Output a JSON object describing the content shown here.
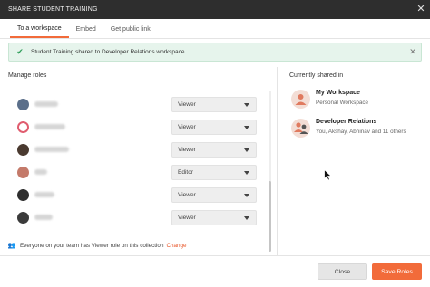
{
  "header": {
    "title": "SHARE STUDENT TRAINING",
    "close_icon": "close-icon"
  },
  "tabs": [
    {
      "label": "To a workspace",
      "active": true
    },
    {
      "label": "Embed",
      "active": false
    },
    {
      "label": "Get public link",
      "active": false
    }
  ],
  "banner": {
    "text": "Student Training shared to Developer Relations workspace.",
    "icon": "check-icon"
  },
  "manage_roles": {
    "title": "Manage roles",
    "rows": [
      {
        "role": "Viewer",
        "avatar_color": "#5b6f8a"
      },
      {
        "role": "Viewer",
        "avatar_color": "#e05d6f"
      },
      {
        "role": "Viewer",
        "avatar_color": "#4a3a30"
      },
      {
        "role": "Editor",
        "avatar_color": "#c47a6a"
      },
      {
        "role": "Viewer",
        "avatar_color": "#2e2e2e"
      },
      {
        "role": "Viewer",
        "avatar_color": "#3b3b3b"
      }
    ]
  },
  "note": {
    "text": "Everyone on your team has Viewer role on this collection",
    "link": "Change"
  },
  "currently_shared": {
    "title": "Currently shared in",
    "items": [
      {
        "name": "My Workspace",
        "subtitle": "Personal Workspace"
      },
      {
        "name": "Developer Relations",
        "subtitle": "You, Akshay, Abhinav and 11 others"
      }
    ]
  },
  "footer": {
    "close_label": "Close",
    "save_label": "Save Roles"
  },
  "colors": {
    "accent": "#f26b3a",
    "header_bg": "#2e2e2e",
    "success_bg": "#e6f4ec"
  }
}
